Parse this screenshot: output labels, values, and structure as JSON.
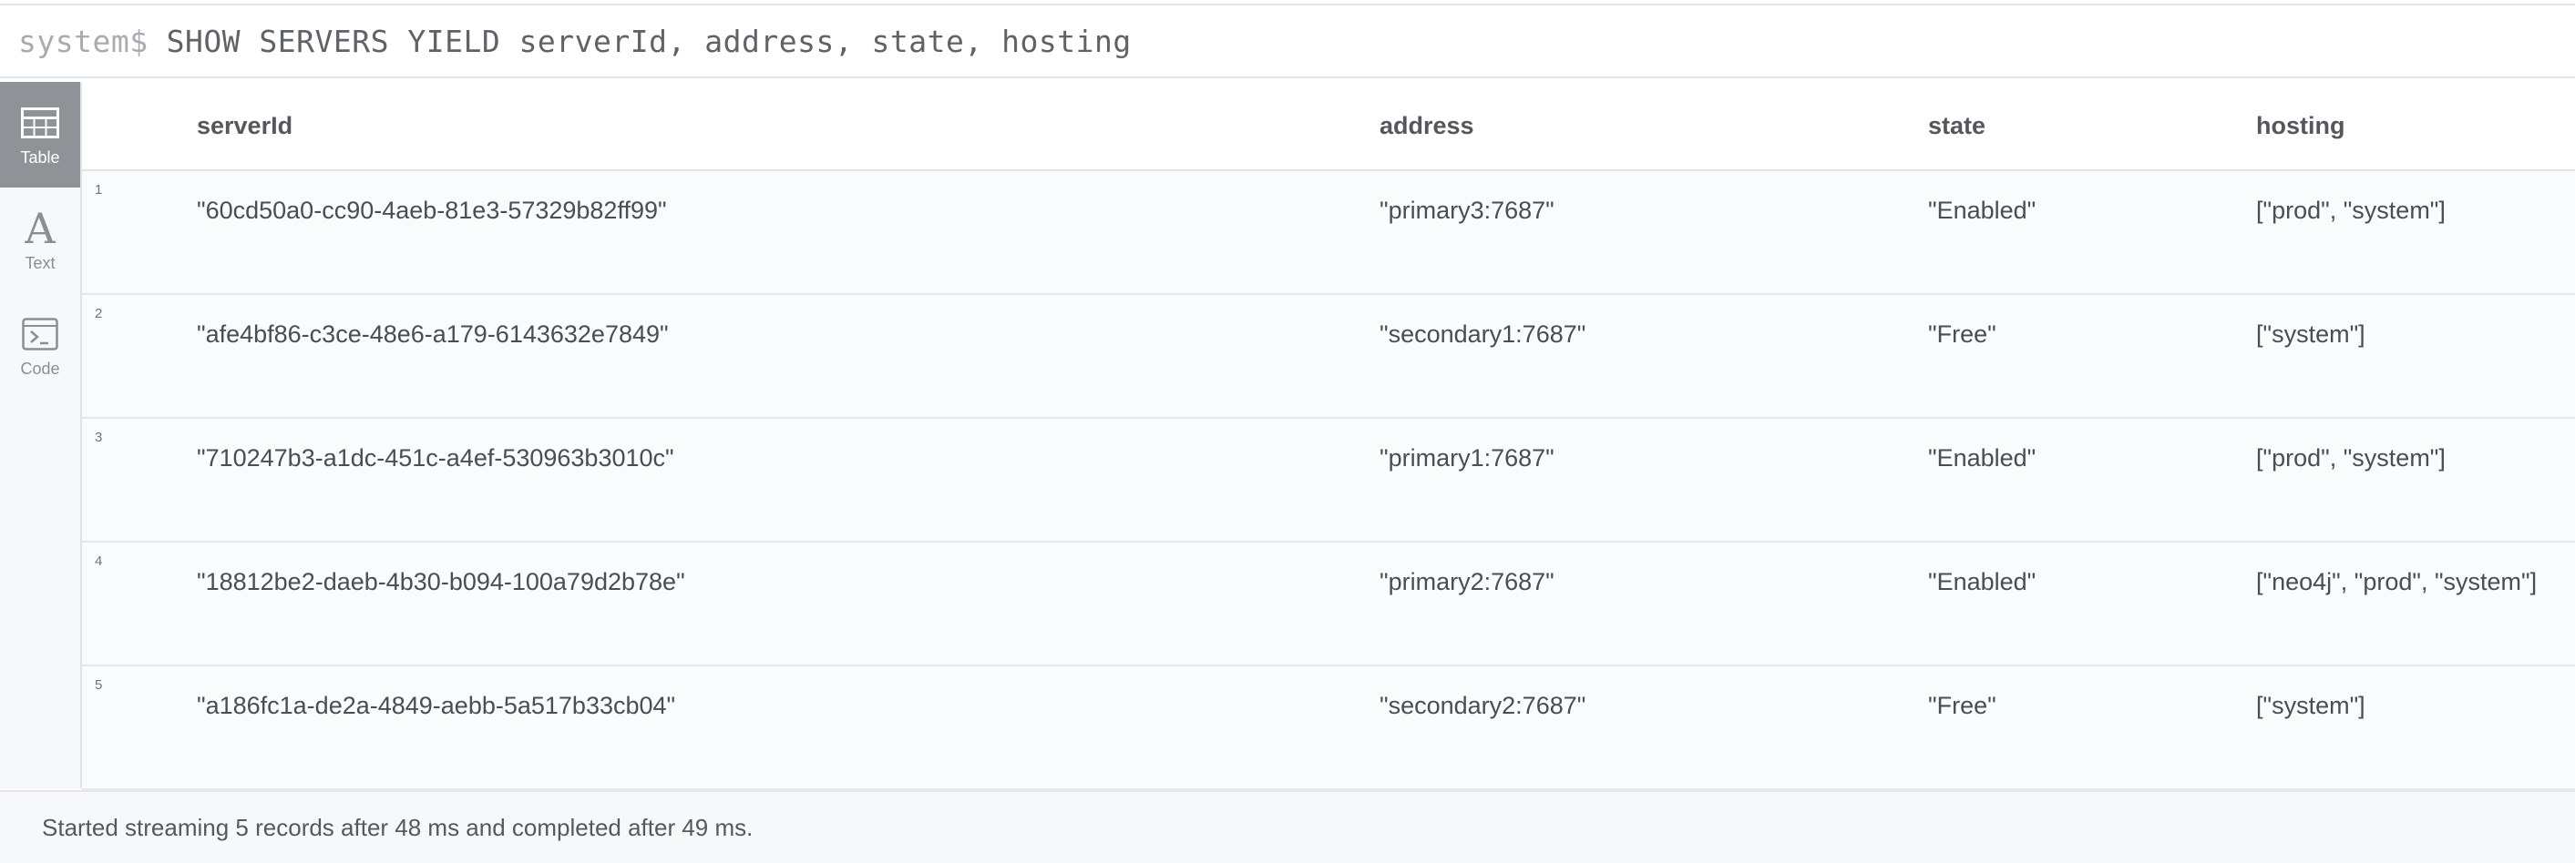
{
  "editor": {
    "prompt": "system$",
    "query": "SHOW SERVERS YIELD serverId, address, state, hosting"
  },
  "sidebar": {
    "items": [
      {
        "label": "Table",
        "icon": "table-icon",
        "active": true
      },
      {
        "label": "Text",
        "icon": "text-icon",
        "active": false
      },
      {
        "label": "Code",
        "icon": "code-icon",
        "active": false
      }
    ]
  },
  "table": {
    "columns": [
      "serverId",
      "address",
      "state",
      "hosting"
    ],
    "rows": [
      {
        "num": "1",
        "cells": [
          "\"60cd50a0-cc90-4aeb-81e3-57329b82ff99\"",
          "\"primary3:7687\"",
          "\"Enabled\"",
          "[\"prod\", \"system\"]"
        ]
      },
      {
        "num": "2",
        "cells": [
          "\"afe4bf86-c3ce-48e6-a179-6143632e7849\"",
          "\"secondary1:7687\"",
          "\"Free\"",
          "[\"system\"]"
        ]
      },
      {
        "num": "3",
        "cells": [
          "\"710247b3-a1dc-451c-a4ef-530963b3010c\"",
          "\"primary1:7687\"",
          "\"Enabled\"",
          "[\"prod\", \"system\"]"
        ]
      },
      {
        "num": "4",
        "cells": [
          "\"18812be2-daeb-4b30-b094-100a79d2b78e\"",
          "\"primary2:7687\"",
          "\"Enabled\"",
          "[\"neo4j\", \"prod\", \"system\"]"
        ]
      },
      {
        "num": "5",
        "cells": [
          "\"a186fc1a-de2a-4849-aebb-5a517b33cb04\"",
          "\"secondary2:7687\"",
          "\"Free\"",
          "[\"system\"]"
        ]
      }
    ]
  },
  "status": {
    "message": "Started streaming 5 records after 48 ms and completed after 49 ms."
  }
}
